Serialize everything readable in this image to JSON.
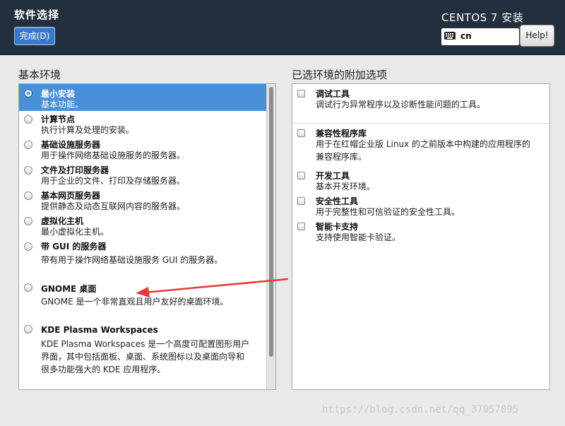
{
  "header": {
    "title": "软件选择",
    "done_button": "完成(D)",
    "product": "CENTOS 7 安装",
    "keyboard_layout": "cn",
    "help_button": "Help!"
  },
  "left_section_title": "基本环境",
  "right_section_title": "已选环境的附加选项",
  "environments": [
    {
      "name": "最小安装",
      "desc": "基本功能。",
      "selected": true
    },
    {
      "name": "计算节点",
      "desc": "执行计算及处理的安装。"
    },
    {
      "name": "基础设施服务器",
      "desc": "用于操作网络基础设施服务的服务器。"
    },
    {
      "name": "文件及打印服务器",
      "desc": "用于企业的文件、打印及存储服务器。"
    },
    {
      "name": "基本网页服务器",
      "desc": "提供静态及动态互联网内容的服务器。"
    },
    {
      "name": "虚拟化主机",
      "desc": "最小虚拟化主机。"
    },
    {
      "name": "带 GUI 的服务器",
      "desc": "带有用于操作网络基础设施服务 GUI 的服务器。"
    },
    {
      "name": "GNOME 桌面",
      "desc": "GNOME 是一个非常直观且用户友好的桌面环境。"
    },
    {
      "name": "KDE Plasma Workspaces",
      "desc_lines": [
        "KDE Plasma Workspaces 是一个高度可配置图形用户",
        "界面，其中包括面板、桌面、系统图标以及桌面向导和",
        "很多功能强大的 KDE 应用程序。"
      ]
    }
  ],
  "addons": [
    {
      "name": "调试工具",
      "desc": "调试行为异常程序以及诊断性能问题的工具。"
    },
    {
      "name": "兼容性程序库",
      "desc_lines": [
        "用于在红帽企业版 Linux 的之前版本中构建的应用程序的",
        "兼容程序库。"
      ]
    },
    {
      "name": "开发工具",
      "desc": "基本开发环境。"
    },
    {
      "name": "安全性工具",
      "desc": "用于完整性和可信验证的安全性工具。"
    },
    {
      "name": "智能卡支持",
      "desc": "支持使用智能卡验证。"
    }
  ],
  "watermark": "https://blog.csdn.net/qq_37057095",
  "colors": {
    "header_bg": "#22303d",
    "selection": "#4a90d9",
    "annotation_arrow": "#e53935"
  }
}
